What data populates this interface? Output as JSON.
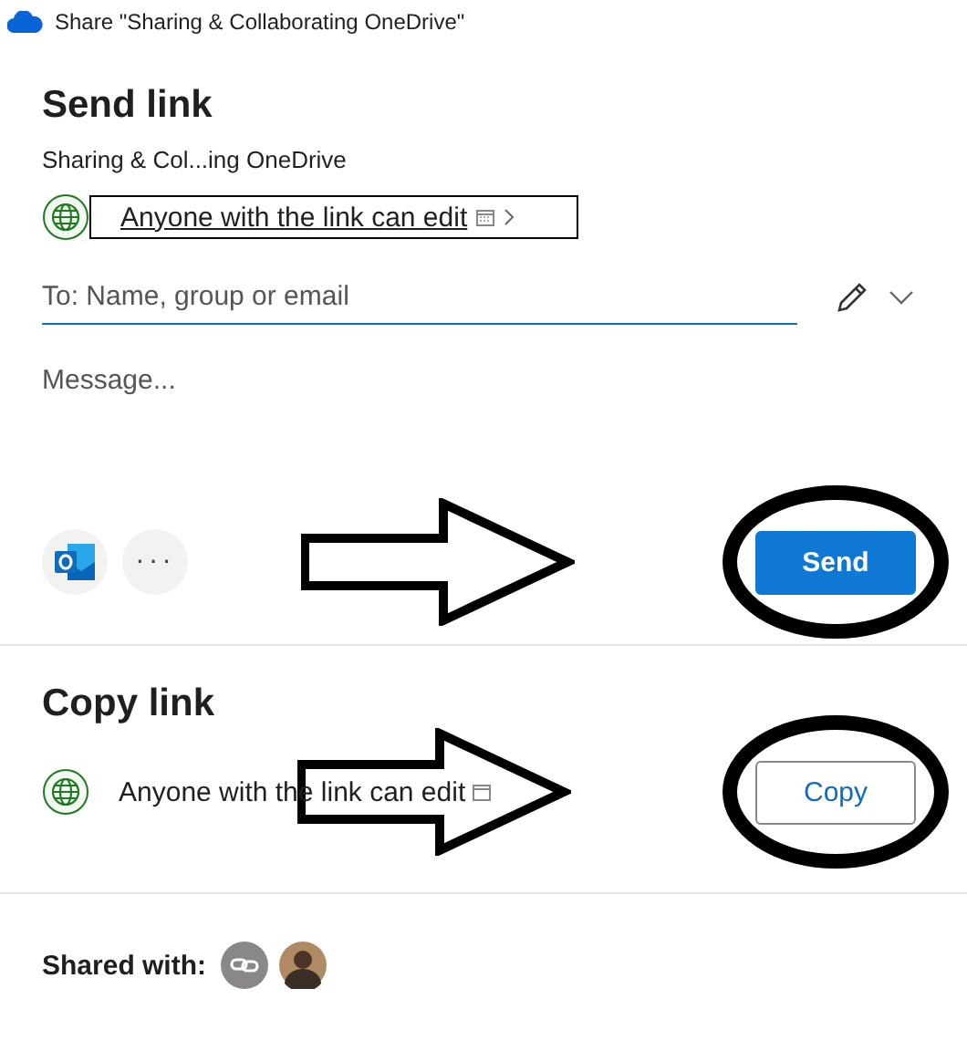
{
  "window": {
    "title": "Share \"Sharing & Collaborating OneDrive\""
  },
  "send_link": {
    "heading": "Send link",
    "file_name": "Sharing & Col...ing OneDrive",
    "link_setting": "Anyone with the link can edit",
    "to_field": {
      "placeholder": "To: Name, group or email"
    },
    "message_field": {
      "placeholder": "Message..."
    },
    "more_button": "···",
    "send_button": "Send"
  },
  "copy_link": {
    "heading": "Copy link",
    "link_setting": "Anyone with the link can edit",
    "copy_button": "Copy"
  },
  "shared_with": {
    "label": "Shared with:"
  }
}
